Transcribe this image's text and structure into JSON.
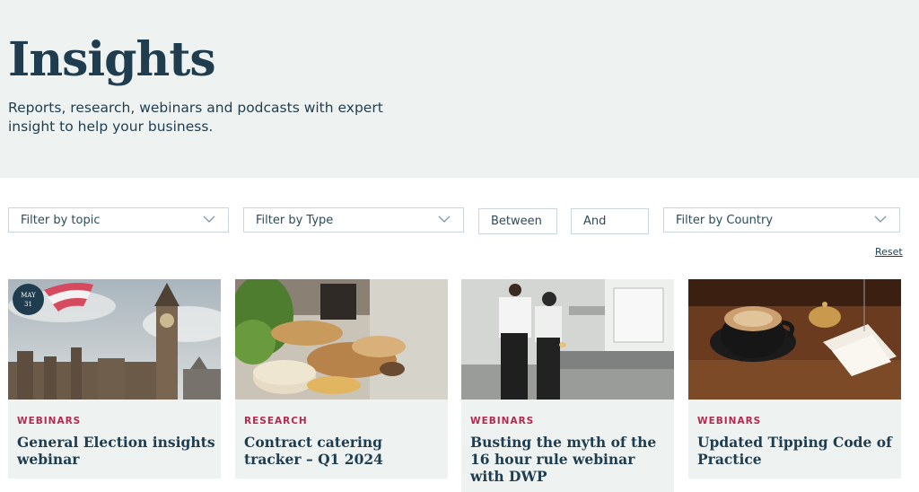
{
  "header": {
    "title": "Insights",
    "subtitle": "Reports, research, webinars and podcasts with expert insight to help your business."
  },
  "filters": {
    "topic": "Filter by topic",
    "type": "Filter by Type",
    "between": "Between",
    "and": "And",
    "country": "Filter by Country",
    "reset": "Reset"
  },
  "cards": [
    {
      "tag": "WEBINARS",
      "title": "General Election insights webinar",
      "badge_month": "MAY",
      "badge_day": "31",
      "image": "big-ben-parliament-photo"
    },
    {
      "tag": "RESEARCH",
      "title": "Contract catering tracker – Q1 2024",
      "image": "catering-buffet-photo"
    },
    {
      "tag": "WEBINARS",
      "title": "Busting the myth of the 16 hour rule webinar with DWP",
      "image": "chefs-kitchen-photo"
    },
    {
      "tag": "WEBINARS",
      "title": "Updated Tipping Code of Practice",
      "image": "coffee-and-receipts-photo"
    }
  ],
  "colors": {
    "navy": "#1f3d4f",
    "tag_red": "#b6284f",
    "hero_bg": "#eef3f2"
  }
}
